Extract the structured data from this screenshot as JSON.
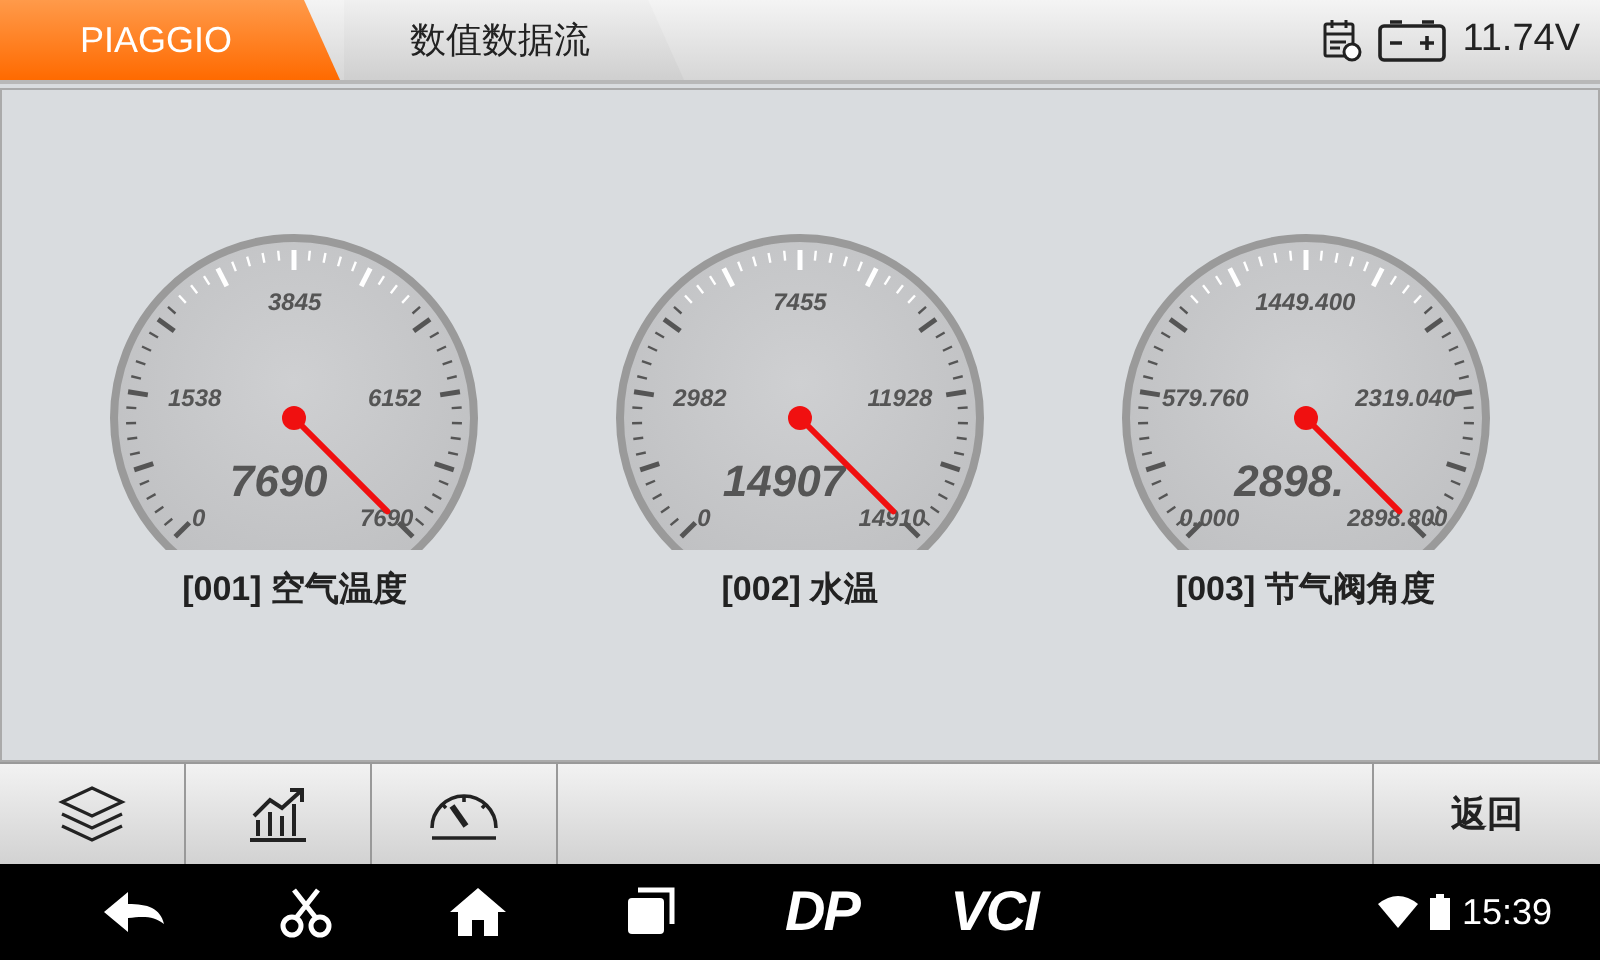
{
  "header": {
    "tabs": [
      {
        "label": "PIAGGIO",
        "selected": true
      },
      {
        "label": "数值数据流",
        "selected": false
      }
    ],
    "voltage": "11.74V"
  },
  "gauges": [
    {
      "value": "7690",
      "level": 1,
      "ticks": [
        "0",
        "1538",
        "3845",
        "6152",
        "7690"
      ],
      "caption": "[001] 空气温度"
    },
    {
      "value": "14907",
      "level": 1,
      "ticks": [
        "0",
        "2982",
        "7455",
        "11928",
        "14910"
      ],
      "caption": "[002] 水温"
    },
    {
      "value": "2898.",
      "level": 1,
      "ticks": [
        "0.000",
        "579.760",
        "1449.400",
        "2319.040",
        "2898.800"
      ],
      "caption": "[003] 节气阀角度"
    }
  ],
  "toolbar": {
    "buttons": [
      {
        "kind": "layers"
      },
      {
        "kind": "chart"
      },
      {
        "kind": "gauge"
      }
    ],
    "back": "返回"
  },
  "navbar": {
    "logos": [
      "DP",
      "VCI"
    ],
    "time": "15:39"
  }
}
